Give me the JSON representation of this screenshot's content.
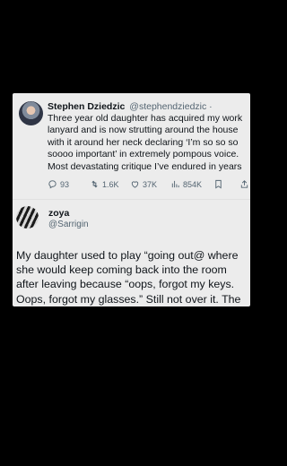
{
  "tweet1": {
    "name": "Stephen Dziedzic",
    "handle_meta": "@stephendziedzic ·",
    "text": "Three year old daughter has acquired my work lanyard and is now strutting around the house with it around her neck declaring ‘I’m so so so soooo important’ in extremely pompous voice. Most devastating critique I’ve endured in years",
    "replies": "93",
    "reposts": "1.6K",
    "likes": "37K",
    "views": "854K"
  },
  "tweet2": {
    "name": "zoya",
    "handle": "@Sarrigin",
    "text": "My daughter used to play “going out@ where she would keep coming back into the room after leaving because “oops, forgot my keys. Oops, forgot my glasses.” Still not over it. The truths."
  }
}
